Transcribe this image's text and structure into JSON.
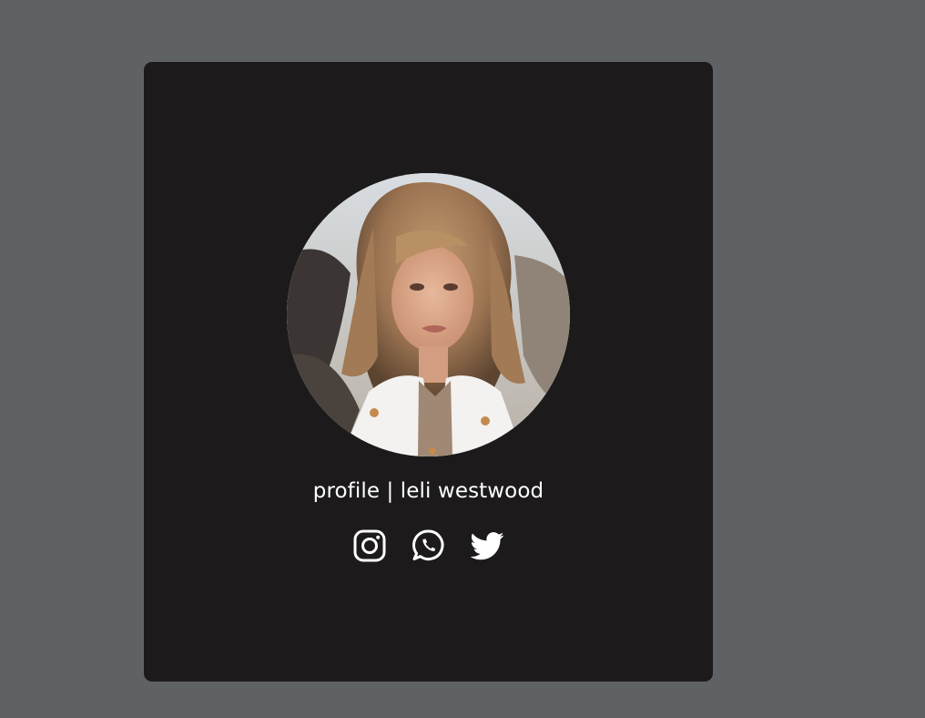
{
  "profile": {
    "title": "profile | leli westwood",
    "avatar_icon": "person-photo"
  },
  "socials": [
    {
      "icon": "instagram-icon"
    },
    {
      "icon": "whatsapp-icon"
    },
    {
      "icon": "twitter-icon"
    }
  ],
  "colors": {
    "page_background": "#5f6265",
    "card_background": "#1c1a1b",
    "text": "#ffffff",
    "icon": "#ffffff"
  }
}
